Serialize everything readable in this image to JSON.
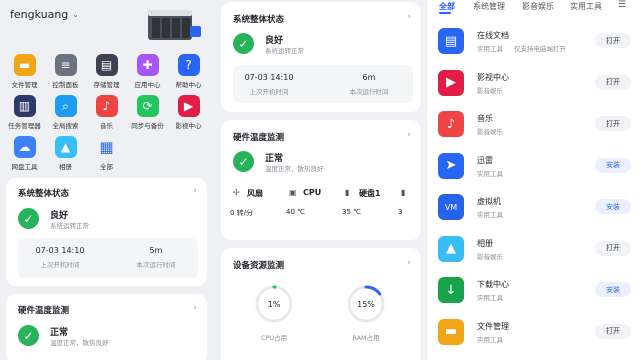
{
  "left": {
    "username": "fengkuang",
    "apps": [
      {
        "label": "文件管理",
        "icon": "folder-icon",
        "color": "#f2a516"
      },
      {
        "label": "控制面板",
        "icon": "control-panel-icon",
        "color": "#6b7280"
      },
      {
        "label": "存储管理",
        "icon": "storage-icon",
        "color": "#3d4250"
      },
      {
        "label": "应用中心",
        "icon": "app-center-icon",
        "color": "#a855f7"
      },
      {
        "label": "帮助中心",
        "icon": "help-icon",
        "color": "#2a66f6"
      },
      {
        "label": "任务管理器",
        "icon": "task-manager-icon",
        "color": "#2b3a67"
      },
      {
        "label": "全局搜索",
        "icon": "search-icon",
        "color": "#1e9cf0"
      },
      {
        "label": "音乐",
        "icon": "music-icon",
        "color": "#ef4444"
      },
      {
        "label": "同步与备份",
        "icon": "sync-icon",
        "color": "#22c55e"
      },
      {
        "label": "影视中心",
        "icon": "video-icon",
        "color": "#e11d48"
      },
      {
        "label": "网盘工具",
        "icon": "cloud-drive-icon",
        "color": "#3b82f6"
      },
      {
        "label": "相册",
        "icon": "photo-icon",
        "color": "#38bdf8"
      },
      {
        "label": "全部",
        "icon": "all-apps-icon",
        "color": "#ffffff"
      }
    ],
    "system": {
      "title": "系统整体状态",
      "status": "良好",
      "status_desc": "系统运转正常",
      "boot_time": "07-03 14:10",
      "boot_label": "上次开机时间",
      "uptime": "5m",
      "uptime_label": "本次运行时间"
    },
    "temp": {
      "title": "硬件温度监测",
      "status": "正常",
      "status_desc": "温度正常，散热良好"
    }
  },
  "mid": {
    "system": {
      "title": "系统整体状态",
      "status": "良好",
      "status_desc": "系统运转正常",
      "boot_time": "07-03 14:10",
      "boot_label": "上次开机时间",
      "uptime": "6m",
      "uptime_label": "本次运行时间"
    },
    "temp": {
      "title": "硬件温度监测",
      "status": "正常",
      "status_desc": "温度正常，散热良好",
      "sensors": [
        {
          "name": "风扇",
          "value": "0 转/分",
          "icon": "fan-icon"
        },
        {
          "name": "CPU",
          "value": "40 ℃",
          "icon": "cpu-icon"
        },
        {
          "name": "硬盘1",
          "value": "35 ℃",
          "icon": "disk-icon"
        },
        {
          "name": "",
          "value": "3",
          "icon": "disk-icon"
        }
      ]
    },
    "resources": {
      "title": "设备资源监测",
      "cpu_value": "1%",
      "cpu_label": "CPU占用",
      "cpu_fraction": 0.01,
      "ram_value": "15%",
      "ram_label": "RAM占用",
      "ram_fraction": 0.15
    }
  },
  "right": {
    "tabs": [
      "全部",
      "系统管理",
      "影音娱乐",
      "实用工具"
    ],
    "items": [
      {
        "name": "在线文档",
        "category": "实用工具",
        "desc": "仅支持电脑端打开",
        "button": "打开",
        "action": "open",
        "icon": "document-icon",
        "color": "#2a66f6"
      },
      {
        "name": "影视中心",
        "category": "影音娱乐",
        "desc": "",
        "button": "打开",
        "action": "open",
        "icon": "video-icon",
        "color": "#e11d48"
      },
      {
        "name": "音乐",
        "category": "影音娱乐",
        "desc": "",
        "button": "打开",
        "action": "open",
        "icon": "music-icon",
        "color": "#ef4444"
      },
      {
        "name": "迅雷",
        "category": "实用工具",
        "desc": "",
        "button": "安装",
        "action": "install",
        "icon": "thunder-icon",
        "color": "#2a66f6"
      },
      {
        "name": "虚拟机",
        "category": "实用工具",
        "desc": "",
        "button": "安装",
        "action": "install",
        "icon": "vm-icon",
        "color": "#2563eb"
      },
      {
        "name": "相册",
        "category": "影音娱乐",
        "desc": "",
        "button": "打开",
        "action": "open",
        "icon": "photo-icon",
        "color": "#38bdf8"
      },
      {
        "name": "下载中心",
        "category": "实用工具",
        "desc": "",
        "button": "安装",
        "action": "install",
        "icon": "download-icon",
        "color": "#16a34a"
      },
      {
        "name": "文件管理",
        "category": "实用工具",
        "desc": "",
        "button": "打开",
        "action": "open",
        "icon": "folder-icon",
        "color": "#f2a516"
      }
    ]
  }
}
